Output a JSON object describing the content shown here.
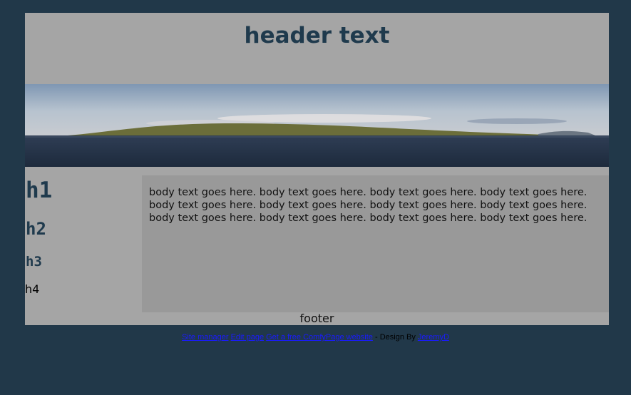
{
  "header": {
    "title": "header text"
  },
  "sidebar": {
    "h1": "h1",
    "h2": "h2",
    "h3": "h3",
    "h4": "h4"
  },
  "content": {
    "body": "body text goes here.  body text goes here.  body text goes here.  body text goes here.  body text goes here.  body text goes here.  body text goes here.  body text goes here.  body text goes here.  body text goes here.  body text goes here.  body text goes here."
  },
  "footer": {
    "text": "footer"
  },
  "bottom_bar": {
    "link_site_manager": "Site manager",
    "link_edit_page": "Edit page",
    "link_get_site": "Get a free ComfyPage website",
    "design_by": " - Design By ",
    "link_designer": "JeremyD"
  },
  "colors": {
    "background": "#213849",
    "page": "#a5a5a5",
    "content_box": "#999999",
    "heading": "#1f3a4d",
    "link": "#1a1aff"
  }
}
